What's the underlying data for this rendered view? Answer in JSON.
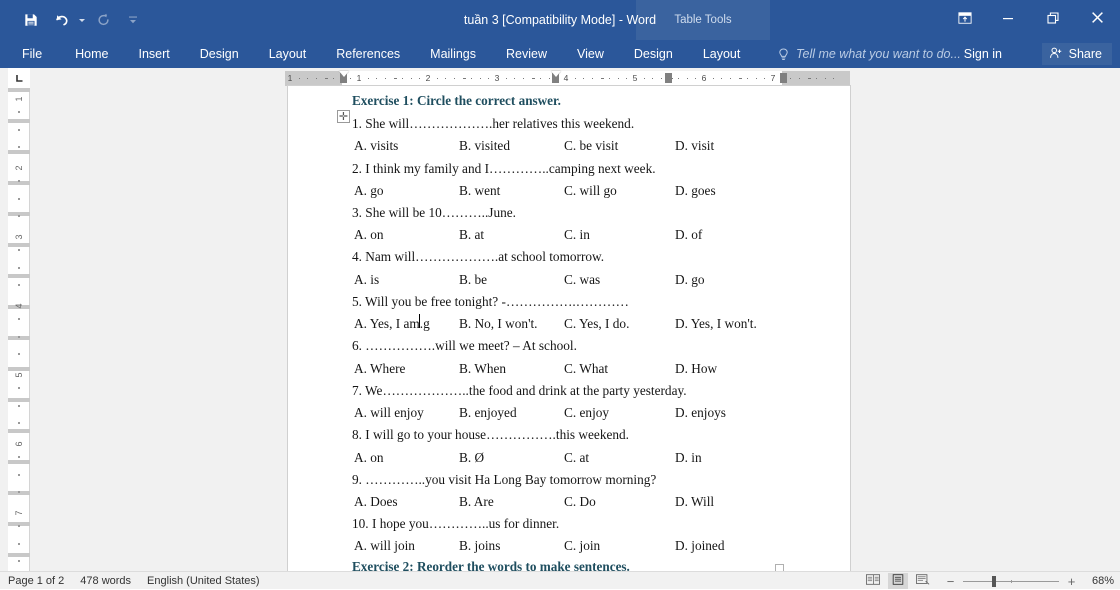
{
  "titlebar": {
    "document_title": "tuần 3 [Compatibility Mode] - Word",
    "contextual_group": "Table Tools",
    "quick_access": [
      {
        "name": "save",
        "icon": "save-icon"
      },
      {
        "name": "undo",
        "icon": "undo-icon"
      },
      {
        "name": "redo",
        "icon": "redo-icon"
      },
      {
        "name": "customize-quick-access-toolbar",
        "icon": "chevron-down-icon"
      }
    ],
    "window_controls": [
      {
        "name": "ribbon-display-options",
        "icon": "ribbon-display-icon"
      },
      {
        "name": "minimize",
        "icon": "minimize-icon"
      },
      {
        "name": "restore",
        "icon": "restore-icon"
      },
      {
        "name": "close",
        "icon": "close-icon"
      }
    ]
  },
  "ribbon": {
    "tabs": [
      "File",
      "Home",
      "Insert",
      "Design",
      "Layout",
      "References",
      "Mailings",
      "Review",
      "View"
    ],
    "contextual_tabs": [
      "Design",
      "Layout"
    ],
    "tell_me_placeholder": "Tell me what you want to do...",
    "sign_in": "Sign in",
    "share": "Share"
  },
  "ruler": {
    "horizontal_numbers": [
      "1",
      "1",
      "2",
      "3",
      "4",
      "5",
      "6",
      "7"
    ],
    "vertical_numbers": [
      "1",
      "2",
      "3",
      "4",
      "5",
      "6",
      "7"
    ]
  },
  "document": {
    "heading_color": "#1f4e5f",
    "heading_1": "Exercise 1: Circle the correct answer.",
    "heading_2": "Exercise 2: Reorder the words to make sentences.",
    "questions": [
      {
        "prompt": "1. She will……………….her relatives this weekend.",
        "options": [
          "A. visits",
          "B. visited",
          "C. be visit",
          "D. visit"
        ]
      },
      {
        "prompt": "2. I think my family and I…………..camping next week.",
        "options": [
          "A. go",
          "B. went",
          "C. will go",
          "D. goes"
        ]
      },
      {
        "prompt": "3. She will be 10………..June.",
        "options": [
          "A. on",
          "B. at",
          "C. in",
          "D. of"
        ]
      },
      {
        "prompt": "4. Nam will……………….at school tomorrow.",
        "options": [
          "A. is",
          "B. be",
          "C. was",
          "D. go"
        ]
      },
      {
        "prompt": "5. Will you be free tonight? -…………….…………",
        "options": [
          "A. Yes, I am.g",
          "B. No, I won't.",
          "C. Yes, I do.",
          "D. Yes, I won't."
        ]
      },
      {
        "prompt": "6. …………….will we meet? – At school.",
        "options": [
          "A. Where",
          "B. When",
          "C. What",
          "D. How"
        ]
      },
      {
        "prompt": "7. We………………..the food and drink at the party yesterday.",
        "options": [
          "A. will enjoy",
          "B. enjoyed",
          "C. enjoy",
          "D. enjoys"
        ]
      },
      {
        "prompt": "8. I will go to your house…………….this weekend.",
        "options": [
          "A. on",
          "B. Ø",
          "C. at",
          "D. in"
        ]
      },
      {
        "prompt": "9. …………..you visit Ha Long Bay tomorrow morning?",
        "options": [
          "A. Does",
          "B. Are",
          "C. Do",
          "D. Will"
        ]
      },
      {
        "prompt": "10. I hope you…………..us for dinner.",
        "options": [
          "A. will join",
          "B. joins",
          "C. join",
          "D. joined"
        ]
      }
    ]
  },
  "statusbar": {
    "page": "Page 1 of 2",
    "words": "478 words",
    "language": "English (United States)",
    "views": [
      {
        "name": "read-mode",
        "active": false
      },
      {
        "name": "print-layout",
        "active": true
      },
      {
        "name": "web-layout",
        "active": false
      }
    ],
    "zoom_percent": "68%"
  }
}
